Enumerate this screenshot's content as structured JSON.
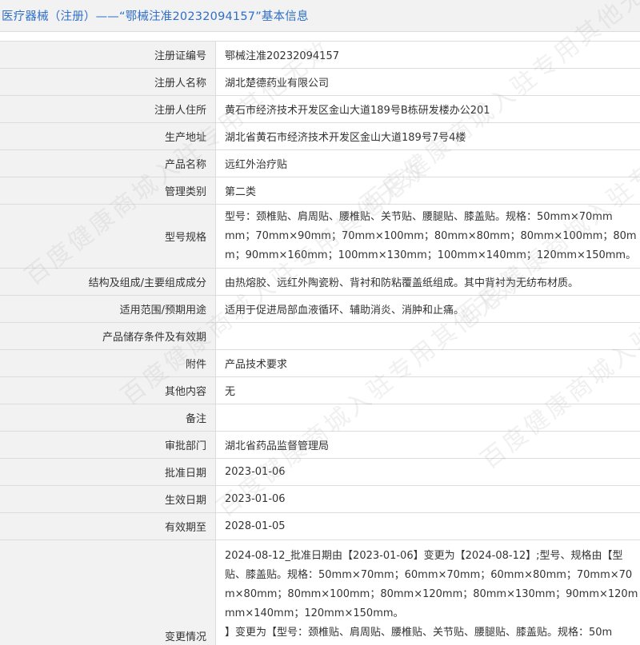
{
  "header": {
    "title": "医疗器械（注册）——“鄂械注准20232094157”基本信息"
  },
  "watermark": "百度健康商城入驻专用其他无效",
  "rows": [
    {
      "label": "注册证编号",
      "value": "鄂械注准20232094157"
    },
    {
      "label": "注册人名称",
      "value": "湖北楚德药业有限公司"
    },
    {
      "label": "注册人住所",
      "value": "黄石市经济技术开发区金山大道189号B栋研发楼办公201"
    },
    {
      "label": "生产地址",
      "value": "湖北省黄石市经济技术开发区金山大道189号7号4楼"
    },
    {
      "label": "产品名称",
      "value": "远红外治疗贴"
    },
    {
      "label": "管理类别",
      "value": "第二类"
    },
    {
      "label": "型号规格",
      "lines": [
        "型号：颈椎贴、肩周贴、腰椎贴、关节贴、腰腿贴、膝盖贴。规格：50mm×70mm",
        "mm；70mm×90mm；70mm×100mm；80mm×80mm；80mm×100mm；80m",
        "m；90mm×160mm；100mm×130mm；100mm×140mm；120mm×150mm。"
      ]
    },
    {
      "label": "结构及组成/主要组成成分",
      "value": "由热熔胶、远红外陶瓷粉、背衬和防粘覆盖纸组成。其中背衬为无纺布材质。"
    },
    {
      "label": "适用范围/预期用途",
      "value": "适用于促进局部血液循环、辅助消炎、消肿和止痛。"
    },
    {
      "label": "产品储存条件及有效期",
      "value": ""
    },
    {
      "label": "附件",
      "value": "产品技术要求"
    },
    {
      "label": "其他内容",
      "value": "无"
    },
    {
      "label": "备注",
      "value": ""
    },
    {
      "label": "审批部门",
      "value": "湖北省药品监督管理局"
    },
    {
      "label": "批准日期",
      "value": "2023-01-06"
    },
    {
      "label": "生效日期",
      "value": "2023-01-06"
    },
    {
      "label": "有效期至",
      "value": "2028-01-05"
    },
    {
      "label": "变更情况",
      "lines": [
        "2024-08-12_批准日期由【2023-01-06】变更为【2024-08-12】;型号、规格由【型",
        "贴、膝盖贴。规格：50mm×70mm；60mm×70mm；60mm×80mm；70mm×70",
        "m×80mm；80mm×100mm；80mm×120mm；80mm×130mm；90mm×120m",
        "mm×140mm；120mm×150mm。",
        "】变更为【型号：颈椎贴、肩周贴、腰椎贴、关节贴、腰腿贴、膝盖贴。规格：50m"
      ]
    }
  ]
}
